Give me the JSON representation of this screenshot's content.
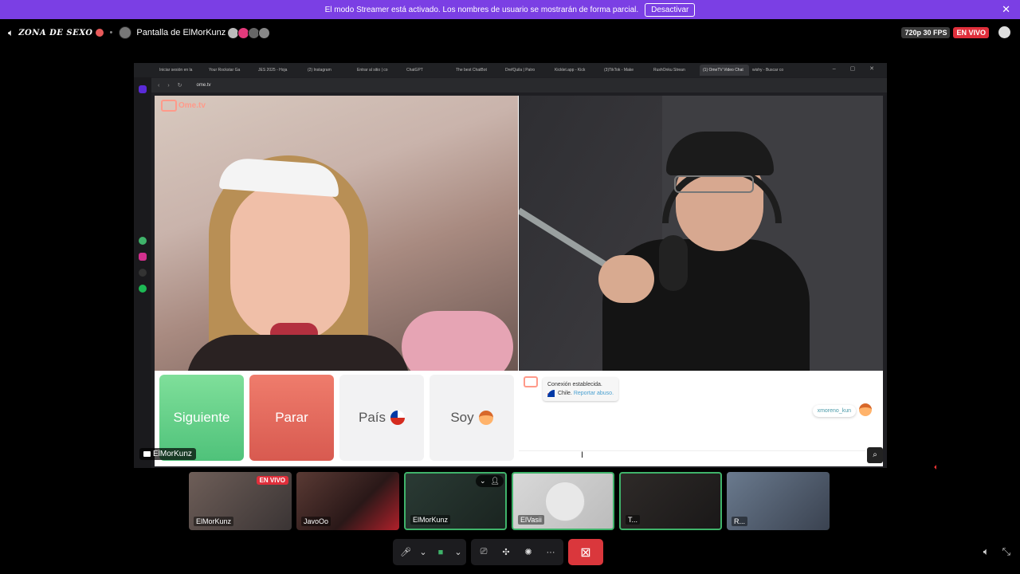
{
  "banner": {
    "text": "El modo Streamer está activado. Los nombres de usuario se mostrarán de forma parcial.",
    "button": "Desactivar",
    "close": "✕"
  },
  "topbar": {
    "channel": "ZONA DE SEXO",
    "stream_title": "Pantalla de ElMorKunz",
    "quality": "720p 30 FPS",
    "live": "EN VIVO"
  },
  "browser": {
    "tabs": [
      "Iniciar sesión en la",
      "Your Rockstar Ga",
      "JES 2025 - Hoja",
      "(2) Instagram",
      "Entrar al sitio | co",
      "ChatGPT",
      "The best ChatBot",
      "DrefQuila | Patro",
      "Kicklet.app - Kick",
      "(3)TikTok - Make",
      "RushOnku Strean",
      "(1) OmeTV Video Chat",
      "wishy - Buscar co"
    ],
    "url": "ome.tv"
  },
  "ometv": {
    "logo": "Ome.tv",
    "buttons": {
      "next": "Siguiente",
      "stop": "Parar",
      "country": "País",
      "me": "Soy"
    },
    "chat": {
      "system_line1": "Conexión establecida.",
      "country": "Chile.",
      "report": "Reportar abuso.",
      "user_message": "xmoreno_kun"
    }
  },
  "screen_owner": "ElMorKunz",
  "participants": [
    {
      "name": "ElMorKunz",
      "live": "EN VIVO"
    },
    {
      "name": "JavoOo"
    },
    {
      "name": "ElMorKunz"
    },
    {
      "name": "ElVasii"
    },
    {
      "name": "T..."
    },
    {
      "name": "R..."
    }
  ],
  "colors": {
    "banner": "#7b3fe4",
    "live": "#e02f3b",
    "speaking": "#3fb36a",
    "leave": "#da373c",
    "next": "#4fc27a",
    "stop": "#d85a50"
  }
}
